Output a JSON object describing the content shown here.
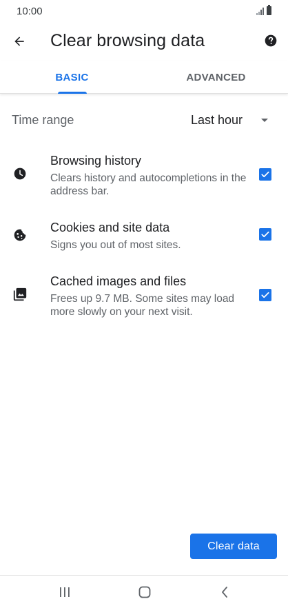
{
  "status_bar": {
    "time": "10:00",
    "signal_icon": "signal-icon",
    "battery_icon": "battery-icon"
  },
  "app_bar": {
    "title": "Clear browsing data",
    "back_icon": "arrow-back-icon",
    "help_icon": "help-circle-icon"
  },
  "tabs": [
    {
      "label": "BASIC",
      "selected": true
    },
    {
      "label": "ADVANCED",
      "selected": false
    }
  ],
  "time_range": {
    "label": "Time range",
    "value": "Last hour"
  },
  "options": [
    {
      "title": "Browsing history",
      "description": "Clears history and autocompletions in the address bar.",
      "icon": "clock-icon",
      "checked": true
    },
    {
      "title": "Cookies and site data",
      "description": "Signs you out of most sites.",
      "icon": "cookie-icon",
      "checked": true
    },
    {
      "title": "Cached images and files",
      "description": "Frees up 9.7 MB. Some sites may load more slowly on your next visit.",
      "icon": "image-icon",
      "checked": true
    }
  ],
  "actions": {
    "clear_label": "Clear data"
  },
  "nav_bar": {
    "recents_icon": "recents-icon",
    "home_icon": "home-icon",
    "back_icon": "nav-back-icon"
  },
  "colors": {
    "accent": "#1a73e8",
    "text_primary": "#202124",
    "text_secondary": "#5f6368"
  }
}
